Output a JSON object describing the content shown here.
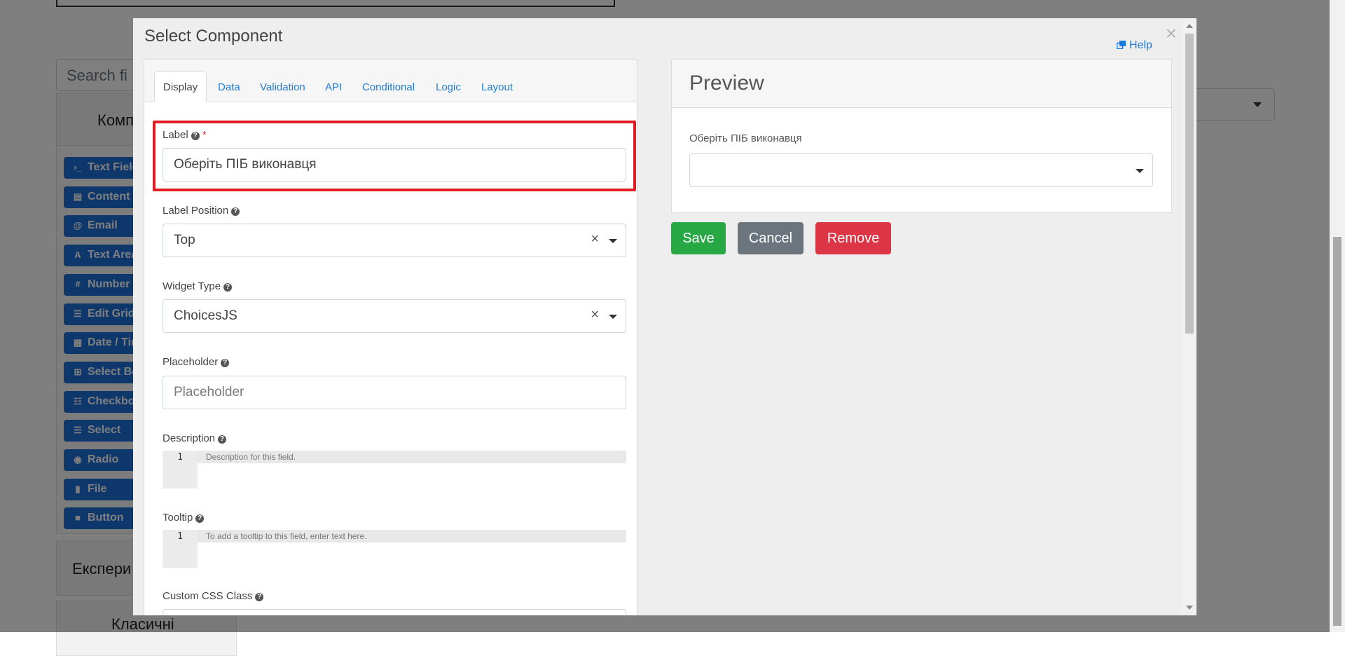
{
  "background": {
    "search_placeholder": "Search fi",
    "panel_title": "Комп",
    "right_select_value": "",
    "components": [
      {
        "icon": "terminal-icon",
        "glyph": "›_",
        "label": "Text Field"
      },
      {
        "icon": "html-icon",
        "glyph": "▤",
        "label": "Content"
      },
      {
        "icon": "at-icon",
        "glyph": "@",
        "label": "Email"
      },
      {
        "icon": "font-icon",
        "glyph": "A",
        "label": "Text Area"
      },
      {
        "icon": "hash-icon",
        "glyph": "#",
        "label": "Number"
      },
      {
        "icon": "tasks-icon",
        "glyph": "☰",
        "label": "Edit Grid"
      },
      {
        "icon": "calendar-icon",
        "glyph": "▦",
        "label": "Date / Time"
      },
      {
        "icon": "plus-square-icon",
        "glyph": "⊞",
        "label": "Select Boxes"
      },
      {
        "icon": "th-list-icon",
        "glyph": "☷",
        "label": "Checkbox"
      },
      {
        "icon": "list-icon",
        "glyph": "☰",
        "label": "Select"
      },
      {
        "icon": "dot-circle-icon",
        "glyph": "◉",
        "label": "Radio"
      },
      {
        "icon": "file-icon",
        "glyph": "▮",
        "label": "File"
      },
      {
        "icon": "stop-icon",
        "glyph": "■",
        "label": "Button"
      }
    ],
    "section_experimental": "Експери",
    "section_classic": "Класичні"
  },
  "modal": {
    "title": "Select Component",
    "help_label": "Help",
    "close_glyph": "×",
    "tabs": [
      {
        "label": "Display",
        "active": true
      },
      {
        "label": "Data",
        "active": false
      },
      {
        "label": "Validation",
        "active": false
      },
      {
        "label": "API",
        "active": false
      },
      {
        "label": "Conditional",
        "active": false
      },
      {
        "label": "Logic",
        "active": false
      },
      {
        "label": "Layout",
        "active": false
      }
    ],
    "fields": {
      "label": {
        "title": "Label",
        "required_mark": "*",
        "value": "Оберіть ПІБ виконавця"
      },
      "label_position": {
        "title": "Label Position",
        "value": "Top"
      },
      "widget_type": {
        "title": "Widget Type",
        "value": "ChoicesJS"
      },
      "placeholder": {
        "title": "Placeholder",
        "placeholder": "Placeholder"
      },
      "description": {
        "title": "Description",
        "line_number": "1",
        "placeholder": "Description for this field."
      },
      "tooltip": {
        "title": "Tooltip",
        "line_number": "1",
        "placeholder": "To add a tooltip to this field, enter text here."
      },
      "custom_css": {
        "title": "Custom CSS Class"
      }
    },
    "preview": {
      "title": "Preview",
      "field_label": "Оберіть ПІБ виконавця",
      "field_value": ""
    },
    "buttons": {
      "save": "Save",
      "cancel": "Cancel",
      "remove": "Remove"
    },
    "colors": {
      "link": "#1e7bd8",
      "save": "#28a745",
      "cancel": "#6c757d",
      "remove": "#dc3545",
      "highlight": "#e31b23"
    }
  }
}
